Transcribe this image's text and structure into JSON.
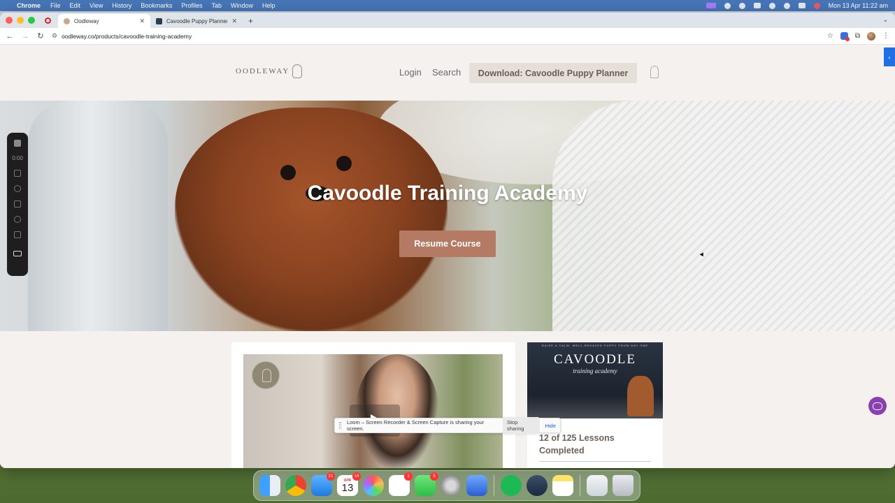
{
  "menubar": {
    "app": "Chrome",
    "items": [
      "File",
      "Edit",
      "View",
      "History",
      "Bookmarks",
      "Profiles",
      "Tab",
      "Window",
      "Help"
    ],
    "clock": "Mon 13 Apr  11:22 am"
  },
  "browser": {
    "tabs": [
      {
        "label": "Oodleway",
        "active": true
      },
      {
        "label": "Cavoodle Puppy Planner Ma...",
        "active": false
      }
    ],
    "new_tab": "+",
    "url": "oodleway.co/products/cavoodle-training-academy"
  },
  "site": {
    "logo_text": "OODLEWAY",
    "nav": {
      "login": "Login",
      "search": "Search"
    },
    "download_button": "Download: Cavoodle Puppy Planner",
    "hero_title": "Cavoodle Training Academy",
    "resume_button": "Resume Course",
    "course_thumb": {
      "tagline": "RAISE A CALM, WELL-BEHAVED PUPPY FROM DAY ONE",
      "brand": "CAVOODLE",
      "script": "training academy"
    },
    "progress_text": "12 of 125 Lessons Completed"
  },
  "loom": {
    "timer": "0:00"
  },
  "share_bar": {
    "message": "Loom – Screen Recorder & Screen Capture is sharing your screen.",
    "stop_label": "Stop sharing",
    "hide_label": "Hide"
  },
  "dock": {
    "calendar": {
      "month": "APR",
      "day": "13"
    },
    "badges": {
      "mail": "21",
      "calendar": "14",
      "reminders": "1",
      "messages": "5"
    }
  }
}
